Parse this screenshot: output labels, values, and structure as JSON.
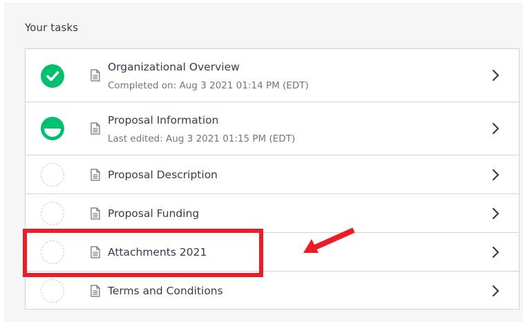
{
  "heading": "Your tasks",
  "colors": {
    "accent_green": "#00bf6f",
    "highlight_red": "#ee1c24",
    "text_primary": "#333e48",
    "text_secondary": "#6b787f"
  },
  "tasks": [
    {
      "title": "Organizational Overview",
      "subtitle": "Completed on: Aug 3 2021 01:14 PM (EDT)",
      "status": "completed",
      "icon": "document-icon"
    },
    {
      "title": "Proposal Information",
      "subtitle": "Last edited: Aug 3 2021 01:15 PM (EDT)",
      "status": "in-progress",
      "icon": "document-icon"
    },
    {
      "title": "Proposal Description",
      "subtitle": "",
      "status": "not-started",
      "icon": "document-icon"
    },
    {
      "title": "Proposal Funding",
      "subtitle": "",
      "status": "not-started",
      "icon": "document-icon"
    },
    {
      "title": "Attachments 2021",
      "subtitle": "",
      "status": "not-started",
      "icon": "document-icon"
    },
    {
      "title": "Terms and Conditions",
      "subtitle": "",
      "status": "not-started",
      "icon": "document-icon"
    }
  ]
}
